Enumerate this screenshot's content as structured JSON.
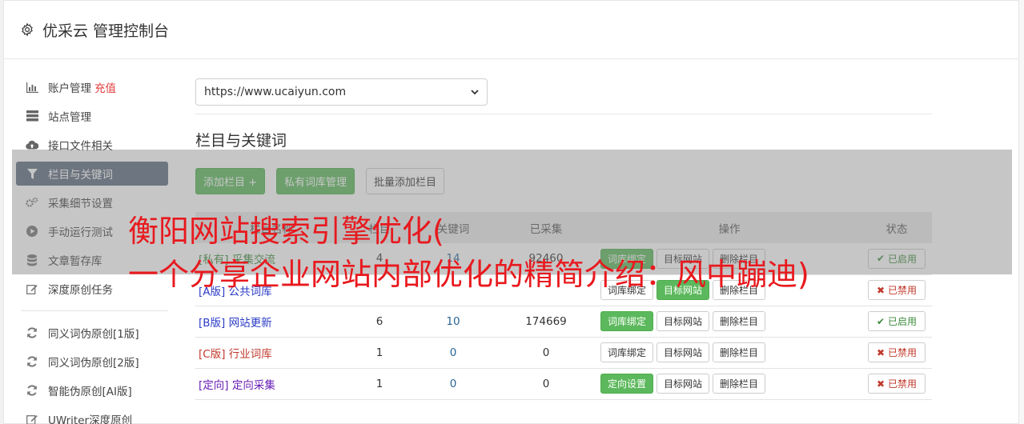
{
  "header": {
    "title": "优采云 管理控制台"
  },
  "sidebar": {
    "items": [
      {
        "label": "账户管理",
        "tag": "充值",
        "icon": "bar-chart-icon"
      },
      {
        "label": "站点管理",
        "icon": "server-icon"
      },
      {
        "label": "接口文件相关",
        "icon": "cloud-upload-icon"
      },
      {
        "label": "栏目与关键词",
        "icon": "filter-icon",
        "active": true
      },
      {
        "label": "采集细节设置",
        "icon": "gears-icon"
      },
      {
        "label": "手动运行测试",
        "icon": "play-icon"
      },
      {
        "label": "文章暂存库",
        "icon": "database-icon"
      },
      {
        "label": "深度原创任务",
        "icon": "edit-icon"
      }
    ],
    "items2": [
      {
        "label": "同义词伪原创[1版]",
        "icon": "refresh-icon"
      },
      {
        "label": "同义词伪原创[2版]",
        "icon": "refresh-icon"
      },
      {
        "label": "智能伪原创[AI版]",
        "icon": "refresh-icon"
      },
      {
        "label": "UWriter深度原创",
        "icon": "edit-icon"
      }
    ]
  },
  "main": {
    "site_select": "https://www.ucaiyun.com",
    "section_title": "栏目与关键词",
    "toolbar": {
      "add_column": "添加栏目 +",
      "private_lib": "私有词库管理",
      "batch_add": "批量添加栏目"
    },
    "table": {
      "headers": [
        "栏目名称",
        "栏目",
        "关键词",
        "已采集",
        "操作",
        "状态"
      ],
      "rows": [
        {
          "tag": "[私有]",
          "name": "采集交流",
          "col": "4",
          "kw": "14",
          "collected": "92460",
          "op1": "词库绑定",
          "op2": "目标网站",
          "op3": "删除栏目",
          "status": "已启用",
          "color": "green",
          "op1_active": true,
          "status_on": true
        },
        {
          "tag": "[A版]",
          "name": "公共词库",
          "col": "",
          "kw": "",
          "collected": "",
          "op1": "词库绑定",
          "op2": "目标网站",
          "op3": "删除栏目",
          "status": "已禁用",
          "color": "blue",
          "op1_active": false,
          "op2_active": true,
          "status_on": false
        },
        {
          "tag": "[B版]",
          "name": "网站更新",
          "col": "6",
          "kw": "10",
          "collected": "174669",
          "op1": "词库绑定",
          "op2": "目标网站",
          "op3": "删除栏目",
          "status": "已启用",
          "color": "blue",
          "op1_active": true,
          "status_on": true
        },
        {
          "tag": "[C版]",
          "name": "行业词库",
          "col": "1",
          "kw": "0",
          "collected": "0",
          "op1": "词库绑定",
          "op2": "目标网站",
          "op3": "删除栏目",
          "status": "已禁用",
          "color": "red",
          "op1_active": false,
          "status_on": false
        },
        {
          "tag": "[定向]",
          "name": "定向采集",
          "col": "1",
          "kw": "0",
          "collected": "0",
          "op1": "定向设置",
          "op2": "目标网站",
          "op3": "删除栏目",
          "status": "已禁用",
          "color": "purple",
          "op1_active": true,
          "status_on": false
        }
      ]
    }
  },
  "overlay": {
    "line1": "衡阳网站搜索引擎优化(",
    "line2": "一个分享企业网站内部优化的精简介绍：风中蹦迪)"
  },
  "colors": {
    "accent_green": "#5cb85c",
    "active_nav": "#5e6e80",
    "overlay_text": "#e8191e"
  }
}
